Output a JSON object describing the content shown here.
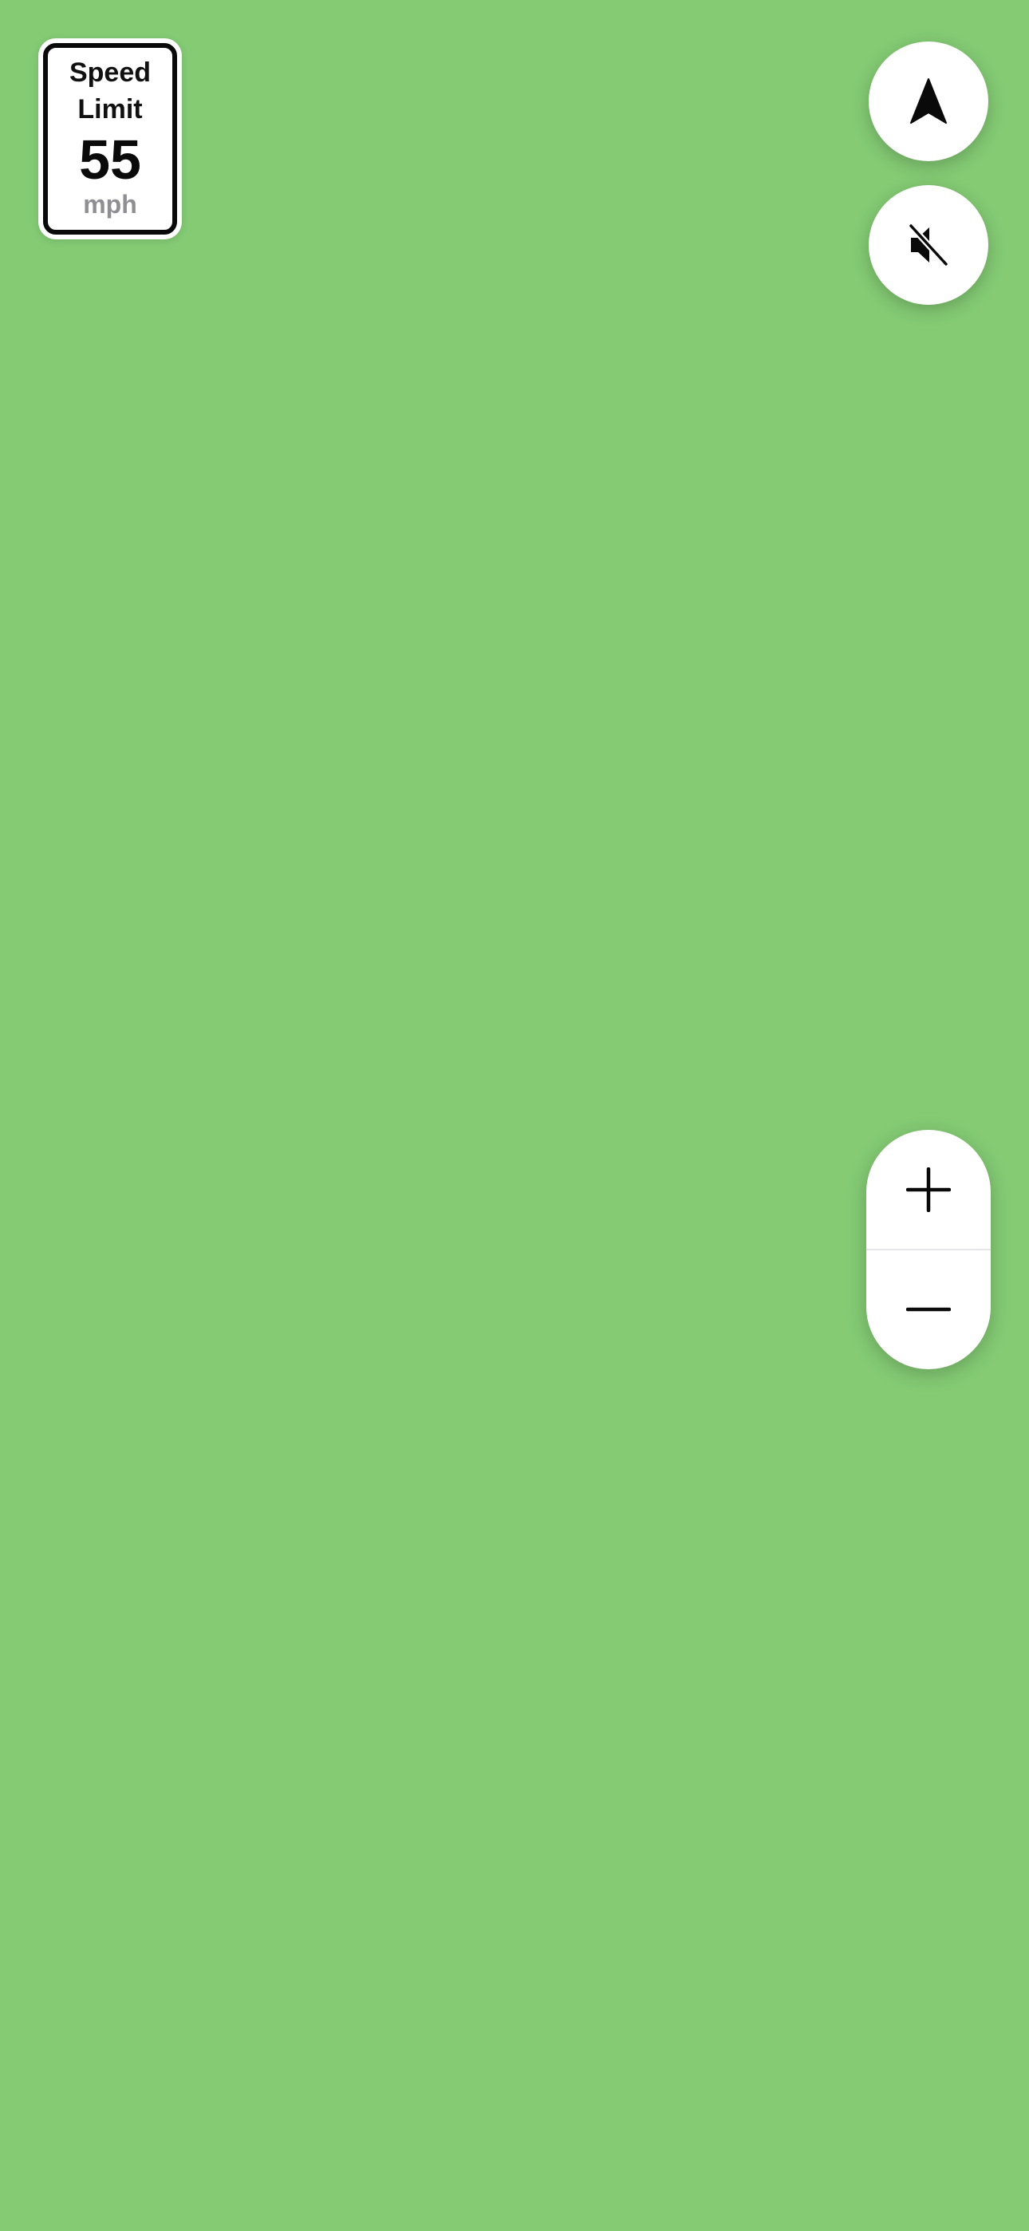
{
  "map": {
    "background_color": "#84cb74"
  },
  "speed_limit": {
    "line1": "Speed",
    "line2": "Limit",
    "value": "55",
    "unit": "mph"
  },
  "controls": {
    "recenter_icon": "navigation-arrow-icon",
    "mute_icon": "speaker-slash-icon",
    "zoom_in_icon": "plus-icon",
    "zoom_out_icon": "minus-icon"
  }
}
